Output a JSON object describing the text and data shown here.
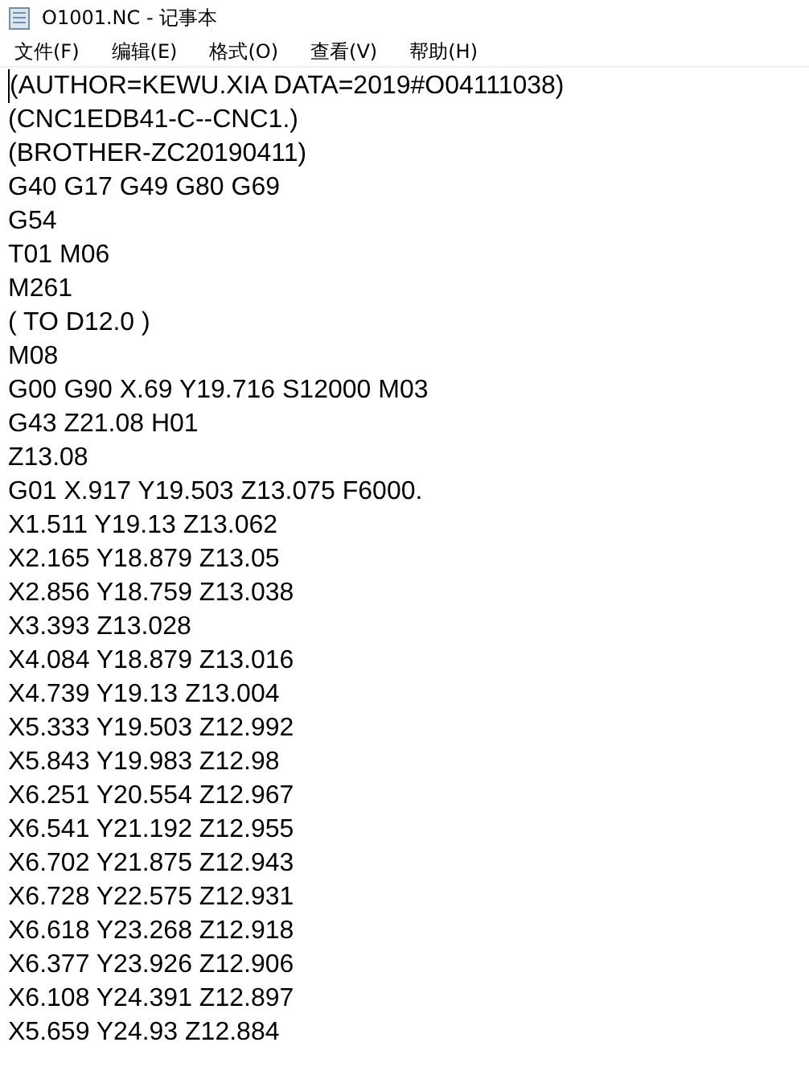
{
  "window": {
    "title": "O1001.NC - 记事本"
  },
  "menu": [
    "文件(F)",
    "编辑(E)",
    "格式(O)",
    "查看(V)",
    "帮助(H)"
  ],
  "lines": [
    "(AUTHOR=KEWU.XIA DATA=2019#O04111038)",
    "(CNC1EDB41-C--CNC1.)",
    "(BROTHER-ZC20190411)",
    "G40 G17 G49 G80 G69",
    "G54",
    "T01 M06",
    "M261",
    "( TO D12.0 )",
    "M08",
    "G00 G90 X.69 Y19.716 S12000 M03",
    "G43 Z21.08 H01",
    "Z13.08",
    "G01 X.917 Y19.503 Z13.075 F6000.",
    "X1.511 Y19.13 Z13.062",
    "X2.165 Y18.879 Z13.05",
    "X2.856 Y18.759 Z13.038",
    "X3.393 Z13.028",
    "X4.084 Y18.879 Z13.016",
    "X4.739 Y19.13 Z13.004",
    "X5.333 Y19.503 Z12.992",
    "X5.843 Y19.983 Z12.98",
    "X6.251 Y20.554 Z12.967",
    "X6.541 Y21.192 Z12.955",
    "X6.702 Y21.875 Z12.943",
    "X6.728 Y22.575 Z12.931",
    "X6.618 Y23.268 Z12.918",
    "X6.377 Y23.926 Z12.906",
    "X6.108 Y24.391 Z12.897",
    "X5.659 Y24.93 Z12.884"
  ]
}
